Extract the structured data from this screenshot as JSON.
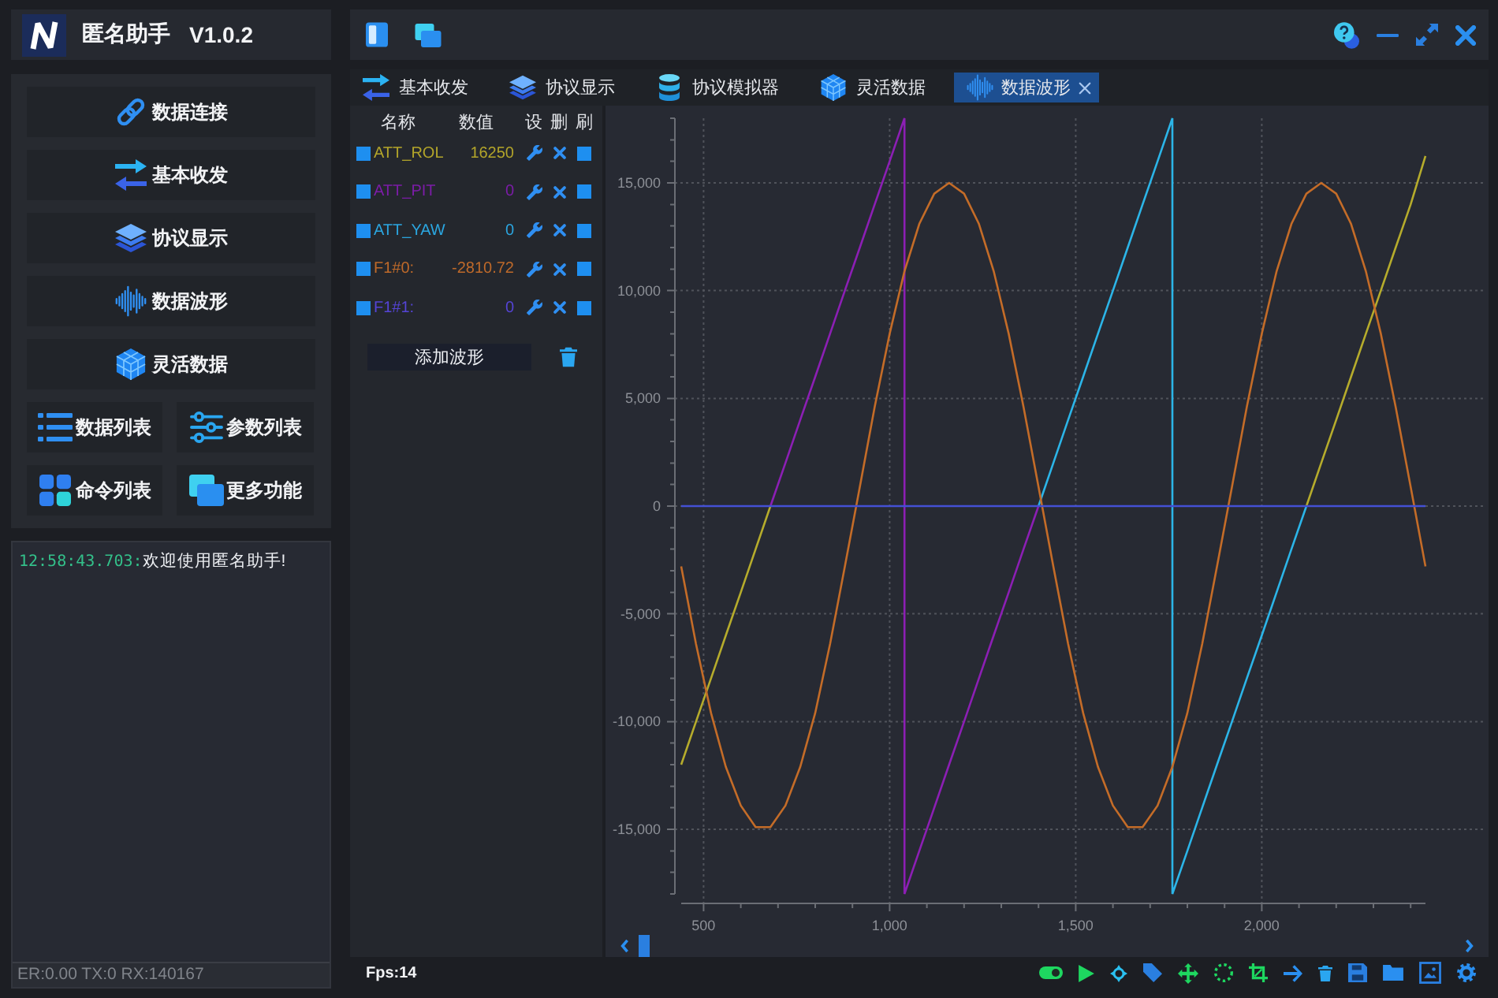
{
  "app": {
    "name": "匿名助手",
    "version": "V1.0.2"
  },
  "sidebar": {
    "main_buttons": [
      "数据连接",
      "基本收发",
      "协议显示",
      "数据波形",
      "灵活数据"
    ],
    "grid_buttons": [
      "数据列表",
      "参数列表",
      "命令列表",
      "更多功能"
    ]
  },
  "log": [
    {
      "time": "12:58:43.703:",
      "message": "欢迎使用匿名助手!"
    }
  ],
  "status_bar": "ER:0.00 TX:0 RX:140167",
  "tabs": [
    {
      "label": "基本收发",
      "selected": false
    },
    {
      "label": "协议显示",
      "selected": false
    },
    {
      "label": "协议模拟器",
      "selected": false
    },
    {
      "label": "灵活数据",
      "selected": false
    },
    {
      "label": "数据波形",
      "selected": true
    }
  ],
  "waveform_table": {
    "columns": [
      "名称",
      "数值",
      "设",
      "删",
      "刷"
    ],
    "rows": [
      {
        "name": "ATT_ROL",
        "value": "16250",
        "color": "#b3a52a"
      },
      {
        "name": "ATT_PIT",
        "value": "0",
        "color": "#7c1ca8"
      },
      {
        "name": "ATT_YAW",
        "value": "0",
        "color": "#2ba6e0"
      },
      {
        "name": "F1#0:",
        "value": "-2810.72",
        "color": "#bf6a2a"
      },
      {
        "name": "F1#1:",
        "value": "0",
        "color": "#5544d6"
      }
    ],
    "add_button": "添加波形"
  },
  "chart": {
    "chart_data": {
      "type": "line",
      "grid": true,
      "x": [
        440,
        480,
        520,
        560,
        600,
        640,
        680,
        720,
        760,
        800,
        840,
        880,
        920,
        960,
        1000,
        1040,
        1040,
        1080,
        1120,
        1160,
        1200,
        1240,
        1280,
        1320,
        1360,
        1400,
        1440,
        1480,
        1520,
        1560,
        1600,
        1640,
        1680,
        1720,
        1760,
        1760,
        1800,
        1840,
        1880,
        1920,
        1960,
        2000,
        2040,
        2080,
        2120,
        2160,
        2200,
        2240,
        2280,
        2320,
        2360,
        2400,
        2440
      ],
      "xlim": [
        440,
        2440
      ],
      "ylim": [
        -18000,
        18000
      ],
      "xticks": [
        {
          "value": 500,
          "label": "500"
        },
        {
          "value": 1000,
          "label": "1,000"
        },
        {
          "value": 1500,
          "label": "1,500"
        },
        {
          "value": 2000,
          "label": "2,000"
        }
      ],
      "yticks": [
        {
          "value": -15000,
          "label": "-15,000"
        },
        {
          "value": -10000,
          "label": "-10,000"
        },
        {
          "value": -5000,
          "label": "-5,000"
        },
        {
          "value": 0,
          "label": "0"
        },
        {
          "value": 5000,
          "label": "5,000"
        },
        {
          "value": 10000,
          "label": "10,000"
        },
        {
          "value": 15000,
          "label": "15,000"
        }
      ],
      "series": [
        {
          "color": "#b6ac2c",
          "values": [
            -12000,
            -10000,
            -8000,
            -6000,
            -4000,
            -2000,
            0,
            null,
            null,
            null,
            null,
            null,
            null,
            null,
            null,
            null,
            null,
            null,
            null,
            null,
            null,
            null,
            null,
            null,
            null,
            null,
            null,
            null,
            null,
            null,
            null,
            null,
            null,
            null,
            null,
            null,
            null,
            null,
            null,
            null,
            null,
            null,
            null,
            null,
            0,
            2000,
            4000,
            6000,
            8000,
            10000,
            12000,
            14000,
            16250
          ]
        },
        {
          "color": "#8c1fb4",
          "values": [
            null,
            null,
            null,
            null,
            null,
            null,
            0,
            2000,
            4000,
            6000,
            8000,
            10000,
            12000,
            14000,
            16000,
            18000,
            -18000,
            -16000,
            -14000,
            -12000,
            -10000,
            -8000,
            -6000,
            -4000,
            -2000,
            0,
            null,
            null,
            null,
            null,
            null,
            null,
            null,
            null,
            null,
            null,
            null,
            null,
            null,
            null,
            null,
            null,
            null,
            null,
            null,
            null,
            null,
            null,
            null,
            null,
            null,
            null,
            null
          ]
        },
        {
          "color": "#2cb5e8",
          "values": [
            null,
            null,
            null,
            null,
            null,
            null,
            null,
            null,
            null,
            null,
            null,
            null,
            null,
            null,
            null,
            null,
            null,
            null,
            null,
            null,
            null,
            null,
            null,
            null,
            null,
            0,
            2000,
            4000,
            6000,
            8000,
            10000,
            12000,
            14000,
            16000,
            18000,
            -18000,
            -16000,
            -14000,
            -12000,
            -10000,
            -8000,
            -6000,
            -4000,
            -2000,
            0,
            null,
            null,
            null,
            null,
            null,
            null,
            null,
            null
          ]
        },
        {
          "color": "#c46c28",
          "values": [
            -2800,
            -6400,
            -9600,
            -12100,
            -13900,
            -14900,
            -14900,
            -13900,
            -12100,
            -9600,
            -6400,
            -2800,
            900,
            4600,
            8000,
            10900,
            10900,
            13100,
            14500,
            15000,
            14500,
            13100,
            10900,
            8000,
            4600,
            900,
            -2800,
            -6400,
            -9600,
            -12100,
            -13900,
            -14900,
            -14900,
            -13900,
            -12100,
            -12100,
            -9600,
            -6400,
            -2800,
            900,
            4600,
            8000,
            10900,
            13100,
            14500,
            15000,
            14500,
            13100,
            10900,
            8000,
            4600,
            900,
            -2800
          ]
        },
        {
          "color": "#4450d4",
          "values": [
            0,
            0,
            0,
            0,
            0,
            0,
            0,
            0,
            0,
            0,
            0,
            0,
            0,
            0,
            0,
            0,
            0,
            0,
            0,
            0,
            0,
            0,
            0,
            0,
            0,
            0,
            0,
            0,
            0,
            0,
            0,
            0,
            0,
            0,
            0,
            0,
            0,
            0,
            0,
            0,
            0,
            0,
            0,
            0,
            0,
            0,
            0,
            0,
            0,
            0,
            0,
            0,
            0
          ]
        }
      ]
    }
  },
  "fps": "Fps:14"
}
